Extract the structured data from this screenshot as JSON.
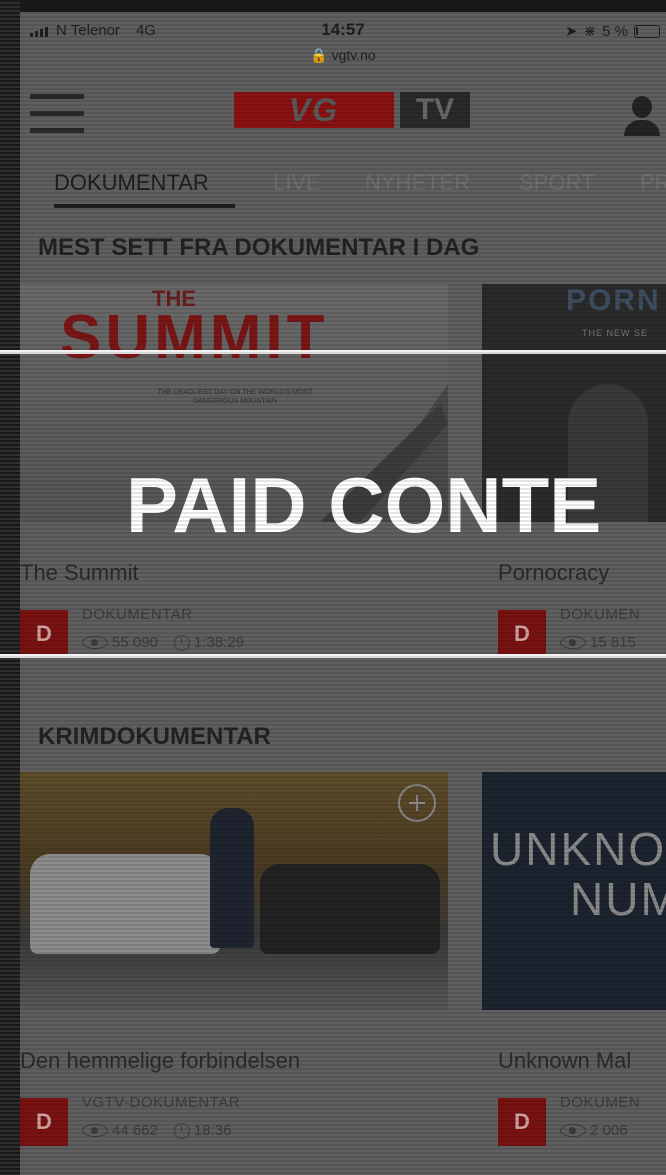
{
  "status_bar": {
    "carrier": "N Telenor",
    "network": "4G",
    "time": "14:57",
    "url": "vgtv.no",
    "battery": "5 %"
  },
  "header": {
    "logo_primary": "VG",
    "logo_secondary": "TV"
  },
  "tabs": [
    {
      "label": "DOKUMENTAR",
      "active": true
    },
    {
      "label": "LIVE",
      "active": false
    },
    {
      "label": "NYHETER",
      "active": false
    },
    {
      "label": "SPORT",
      "active": false
    },
    {
      "label": "PR",
      "active": false
    }
  ],
  "sections": [
    {
      "title": "MEST SETT FRA DOKUMENTAR I DAG",
      "cards": [
        {
          "title": "The Summit",
          "thumb_title": "SUMMIT",
          "thumb_the": "THE",
          "thumb_tagline": "THE DEADLIEST DAY ON THE WORLD'S MOST DANGEROUS MOUNTAIN",
          "badge": "D",
          "channel": "DOKUMENTAR",
          "views": "55 090",
          "duration": "1:38:29"
        },
        {
          "title": "Pornocracy",
          "thumb_title": "PORN",
          "thumb_sub": "THE NEW SE",
          "badge": "D",
          "channel": "DOKUMEN",
          "views": "15 815",
          "duration": ""
        }
      ]
    },
    {
      "title": "KRIMDOKUMENTAR",
      "cards": [
        {
          "title": "Den hemmelige forbindelsen",
          "badge": "D",
          "channel": "VGTV-DOKUMENTAR",
          "views": "44 662",
          "duration": "18:36"
        },
        {
          "title": "Unknown Mal",
          "thumb_line1": "UNKNOW",
          "thumb_line2": "NUM",
          "badge": "D",
          "channel": "DOKUMEN",
          "views": "2 006",
          "duration": ""
        }
      ]
    }
  ],
  "overlay": {
    "text": "PAID CONTE"
  },
  "colors": {
    "vg_red": "#8a1212",
    "overlay_white": "#ffffff",
    "dim_background": "#5f5f5f"
  }
}
